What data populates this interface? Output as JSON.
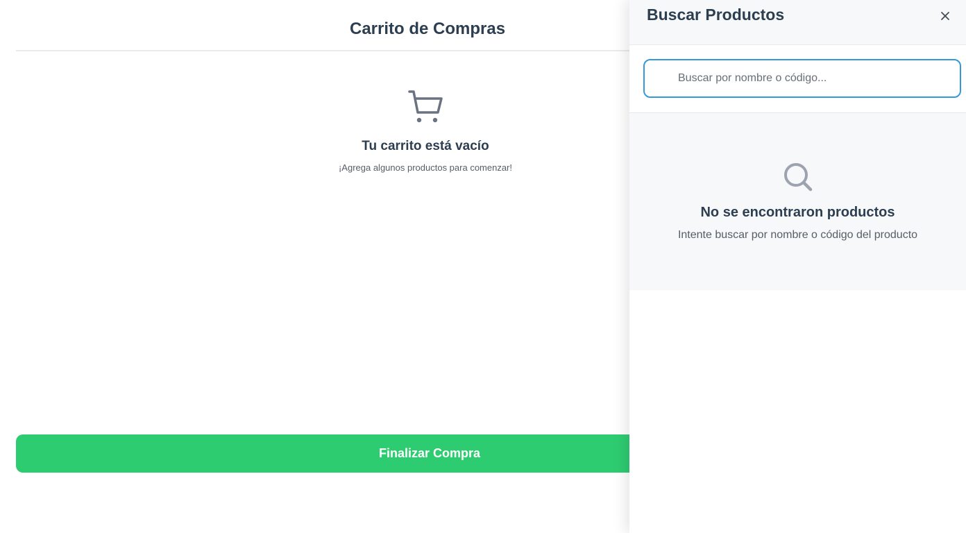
{
  "cart": {
    "title": "Carrito de Compras",
    "empty_title": "Tu carrito está vacío",
    "empty_subtitle": "¡Agrega algunos productos para comenzar!",
    "checkout_label": "Finalizar Compra",
    "cart_icon": "shopping-cart-icon"
  },
  "search_panel": {
    "title": "Buscar Productos",
    "close_icon": "close-icon",
    "search_value": "",
    "search_placeholder": "Buscar por nombre o código...",
    "no_results_icon": "search-icon",
    "no_results_title": "No se encontraron productos",
    "no_results_subtitle": "Intente buscar por nombre o código del producto"
  },
  "colors": {
    "accent": "#2ecc71",
    "focus_border": "#3498db",
    "text_dark": "#2c3e50",
    "icon_gray": "#6b7280"
  }
}
